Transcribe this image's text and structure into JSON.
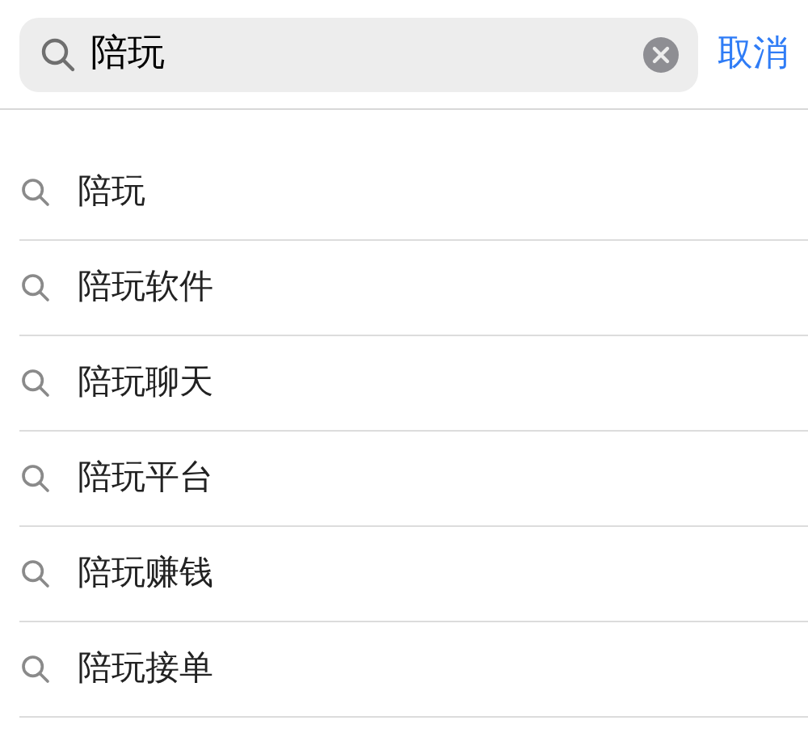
{
  "search": {
    "value": "陪玩",
    "cancel": "取消"
  },
  "suggestions": [
    "陪玩",
    "陪玩软件",
    "陪玩聊天",
    "陪玩平台",
    "陪玩赚钱",
    "陪玩接单"
  ]
}
